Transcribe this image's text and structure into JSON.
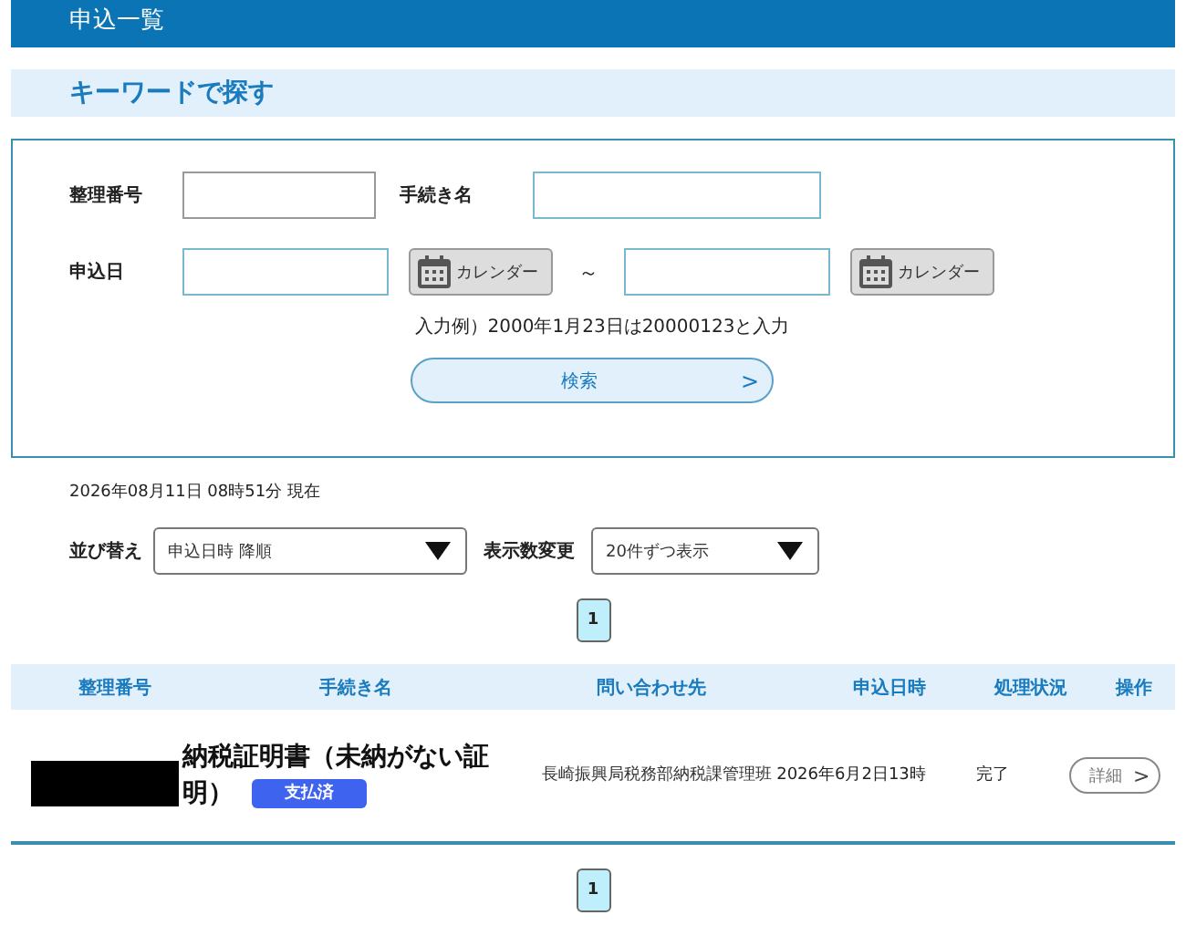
{
  "page_title": "申込一覧",
  "search_section": {
    "heading": "キーワードで探す",
    "text_fields": [
      {
        "label": "整理番号"
      },
      {
        "label": "手続き名"
      }
    ],
    "date_field": {
      "label": "申込日",
      "calendar_buttons": [
        "カレンダー",
        "カレンダー"
      ],
      "separator": "～"
    },
    "hint": "入力例）2000年1月23日は20000123と入力",
    "search_button": {
      "label": "検索",
      "arrow": ">"
    }
  },
  "timestamp": "2026年08月11日 08時51分 現在",
  "sort": {
    "label": "並び替え",
    "value": "申込日時 降順"
  },
  "page_size": {
    "label": "表示数変更",
    "value": "20件ずつ表示"
  },
  "pagination_top": [
    {
      "label": "1",
      "selected": true
    }
  ],
  "table": {
    "columns": [
      "整理番号",
      "手続き名",
      "問い合わせ先",
      "申込日時",
      "処理状況",
      "操作"
    ],
    "rows": [
      {
        "procedure": "納税証明書（未納がない証明）",
        "badge": "支払済",
        "contact": "長崎振興局税務部納税課管理班",
        "date": "2026年6月2日13時",
        "status": "完了",
        "action": {
          "label": "詳細",
          "arrow": ">"
        }
      }
    ]
  },
  "pagination_bottom": [
    {
      "label": "1",
      "selected": true
    }
  ]
}
